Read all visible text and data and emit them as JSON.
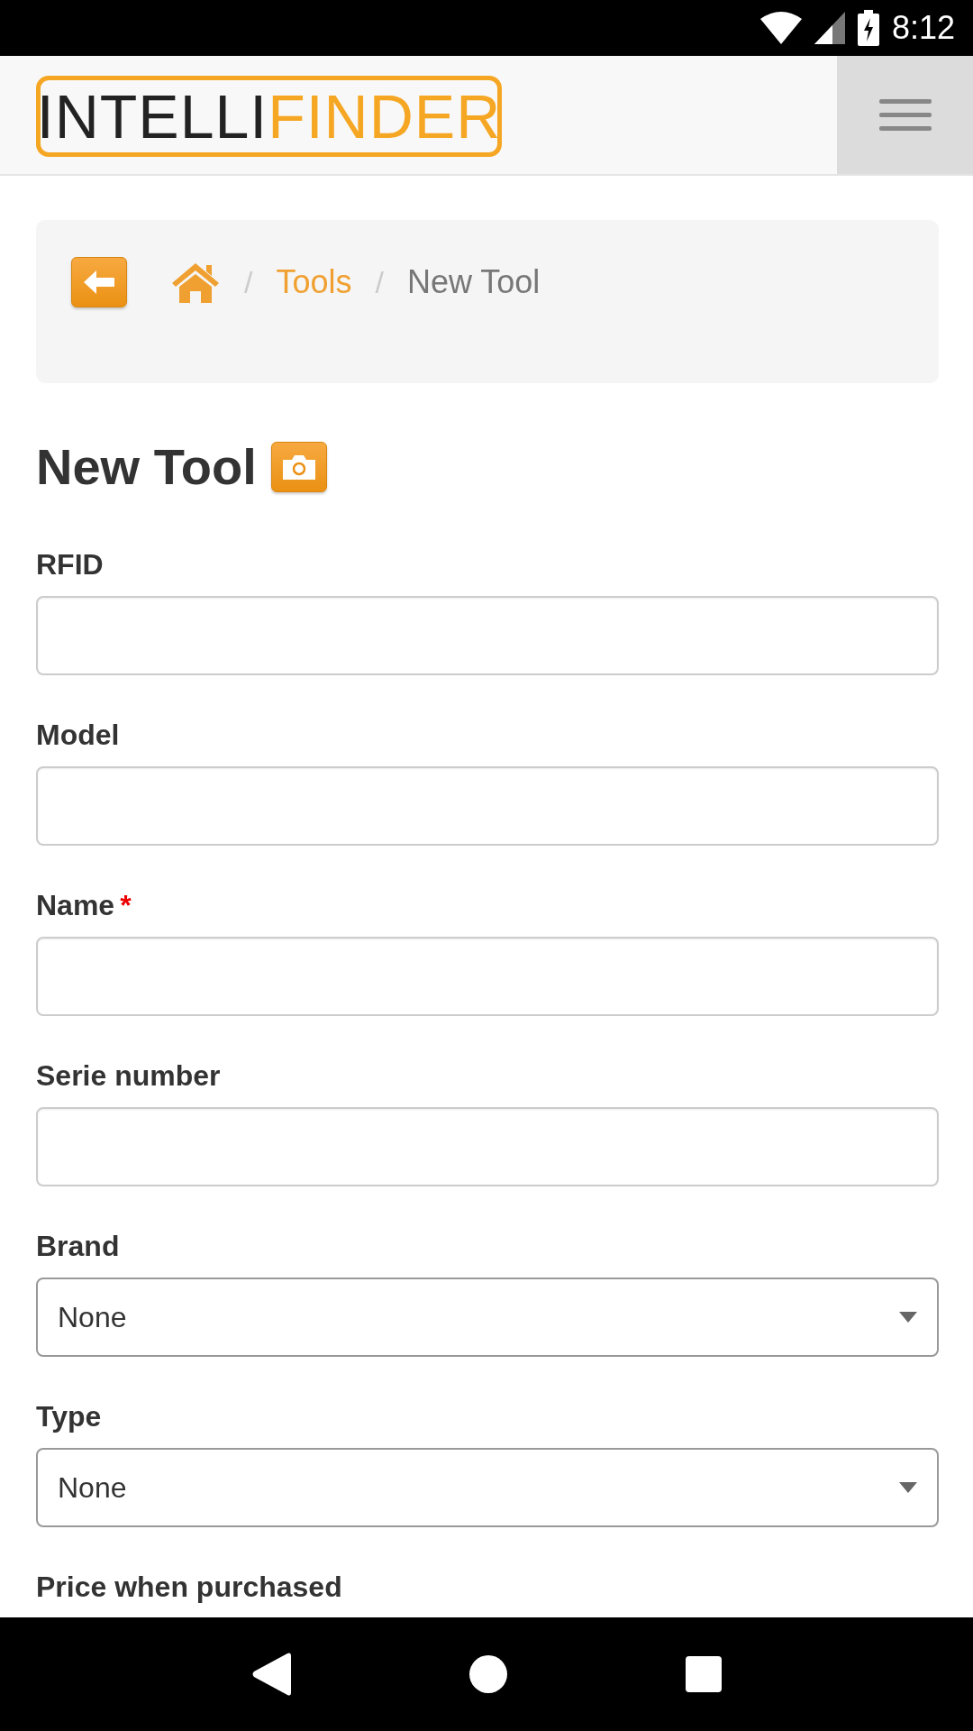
{
  "status_bar": {
    "time": "8:12"
  },
  "navbar": {
    "logo": {
      "part1": "INTELLI",
      "part2": "FINDER"
    }
  },
  "breadcrumb": {
    "separator": "/",
    "items": [
      {
        "kind": "home"
      },
      {
        "kind": "link",
        "label": "Tools"
      },
      {
        "kind": "current",
        "label": "New Tool"
      }
    ]
  },
  "title": "New Tool",
  "fields": [
    {
      "kind": "input",
      "label": "RFID"
    },
    {
      "kind": "input",
      "label": "Model"
    },
    {
      "kind": "input",
      "label": "Name",
      "required_marker": "*"
    },
    {
      "kind": "input",
      "label": "Serie number"
    },
    {
      "kind": "select",
      "label": "Brand",
      "value": "None"
    },
    {
      "kind": "select",
      "label": "Type",
      "value": "None"
    },
    {
      "kind": "label",
      "label": "Price when purchased"
    }
  ]
}
